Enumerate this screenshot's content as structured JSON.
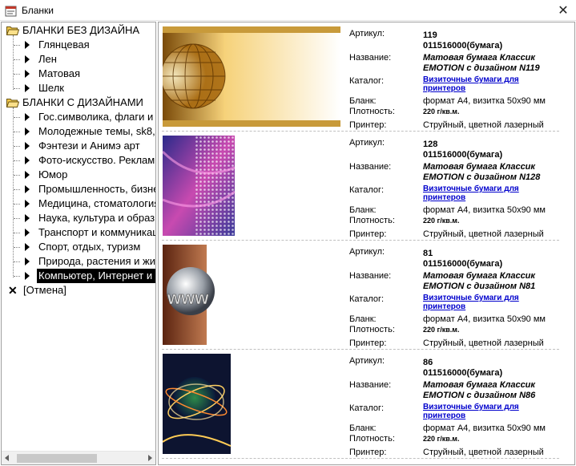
{
  "window": {
    "title": "Бланки"
  },
  "tree": {
    "groups": [
      {
        "label": "БЛАНКИ БЕЗ ДИЗАЙНА",
        "items": [
          "Глянцевая",
          "Лен",
          "Матовая",
          "Шелк"
        ]
      },
      {
        "label": "БЛАНКИ С ДИЗАЙНАМИ",
        "items": [
          "Гос.символика, флаги и",
          "Молодежные темы, sk8,",
          "Фэнтези и Анимэ арт",
          "Фото-искусство. Реклам",
          "Юмор",
          "Промышленность, бизне",
          "Медицина, стоматология",
          "Наука, культура и образ",
          "Транспорт и коммуникац",
          "Спорт, отдых, туризм",
          "Природа, растения и жи",
          "Компьютер, Интернет и"
        ]
      }
    ],
    "cancel": "[Отмена]",
    "selected_index": 11
  },
  "labels": {
    "article": "Артикул:",
    "name": "Название:",
    "catalog": "Каталог:",
    "blank": "Бланк:",
    "density": "Плотность:",
    "printer": "Принтер:"
  },
  "products": [
    {
      "article": "119",
      "code": "011516000(бумага)",
      "name_line1": "Матовая бумага Классик",
      "name_line2": "EMOTION с дизайном N119",
      "catalog": "Визиточные бумаги для принтеров",
      "blank": "формат А4, визитка 50x90 мм",
      "density": "220 г/кв.м.",
      "printer": "Струйный, цветной лазерный",
      "image": "golden-globe-grid"
    },
    {
      "article": "128",
      "code": "011516000(бумага)",
      "name_line1": "Матовая бумага Классик",
      "name_line2": "EMOTION с дизайном N128",
      "catalog": "Визиточные бумаги для принтеров",
      "blank": "формат А4, визитка 50x90 мм",
      "density": "220 г/кв.м.",
      "printer": "Струйный, цветной лазерный",
      "image": "purple-halftone"
    },
    {
      "article": "81",
      "code": "011516000(бумага)",
      "name_line1": "Матовая бумага Классик",
      "name_line2": "EMOTION с дизайном N81",
      "catalog": "Визиточные бумаги для принтеров",
      "blank": "формат А4, визитка 50x90 мм",
      "density": "220 г/кв.м.",
      "printer": "Струйный, цветной лазерный",
      "image": "chrome-globe-www"
    },
    {
      "article": "86",
      "code": "011516000(бумага)",
      "name_line1": "Матовая бумага Классик",
      "name_line2": "EMOTION с дизайном N86",
      "catalog": "Визиточные бумаги для принтеров",
      "blank": "формат А4, визитка 50x90 мм",
      "density": "220 г/кв.м.",
      "printer": "Струйный, цветной лазерный",
      "image": "globe-light-trails"
    }
  ],
  "colors": {
    "link": "#0000cc",
    "selection": "#000000",
    "folder": "#f2c94c"
  }
}
